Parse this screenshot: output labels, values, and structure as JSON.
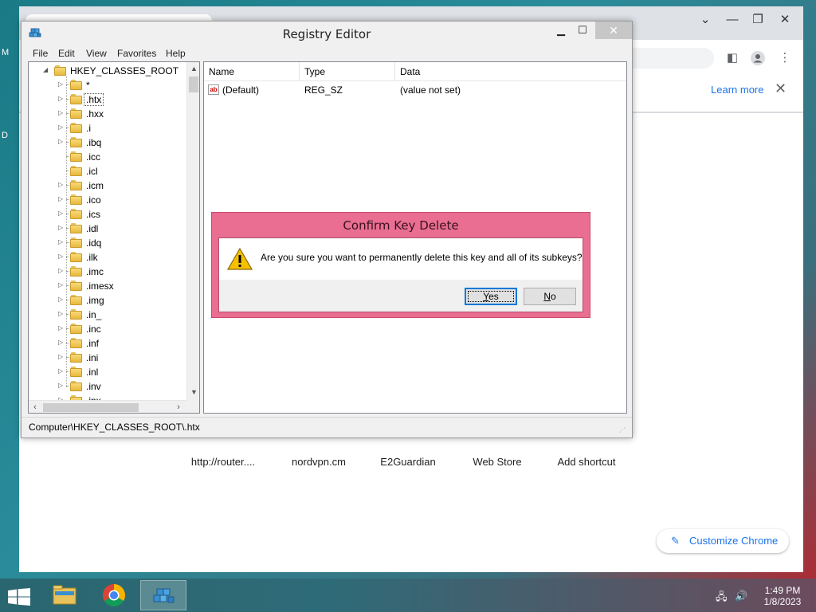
{
  "desktop": {
    "left_texts": [
      "M",
      "D"
    ]
  },
  "chrome": {
    "learn_more": "Learn more",
    "info_close": "✕",
    "shortcuts": [
      "http://router....",
      "nordvpn.cm",
      "E2Guardian",
      "Web Store",
      "Add shortcut"
    ],
    "customize": "Customize Chrome",
    "icons": [
      "chevron-down-icon",
      "minimize-icon",
      "restore-icon",
      "close-icon",
      "side-panel-icon",
      "profile-icon",
      "more-icon",
      "pencil-icon"
    ]
  },
  "regedit": {
    "title": "Registry Editor",
    "menu": [
      "File",
      "Edit",
      "View",
      "Favorites",
      "Help"
    ],
    "root_key": "HKEY_CLASSES_ROOT",
    "keys": [
      "*",
      ".htx",
      ".hxx",
      ".i",
      ".ibq",
      ".icc",
      ".icl",
      ".icm",
      ".ico",
      ".ics",
      ".idl",
      ".idq",
      ".ilk",
      ".imc",
      ".imesx",
      ".img",
      ".in_",
      ".inc",
      ".inf",
      ".ini",
      ".inl",
      ".inv",
      ".inx"
    ],
    "keys_without_expander": [
      ".icc",
      ".icl"
    ],
    "selected_key": ".htx",
    "columns": [
      "Name",
      "Type",
      "Data"
    ],
    "values": [
      {
        "name": "(Default)",
        "type": "REG_SZ",
        "data": "(value not set)"
      }
    ],
    "status_path": "Computer\\HKEY_CLASSES_ROOT\\.htx"
  },
  "dialog": {
    "title": "Confirm Key Delete",
    "message": "Are you sure you want to permanently delete this key and all of its subkeys?",
    "yes_accel": "Y",
    "yes_rest": "es",
    "no_accel": "N",
    "no_rest": "o",
    "accent": "#e96e91"
  },
  "taskbar": {
    "time": "1:49 PM",
    "date": "1/8/2023",
    "items": [
      "file-explorer",
      "chrome",
      "registry-editor"
    ]
  }
}
